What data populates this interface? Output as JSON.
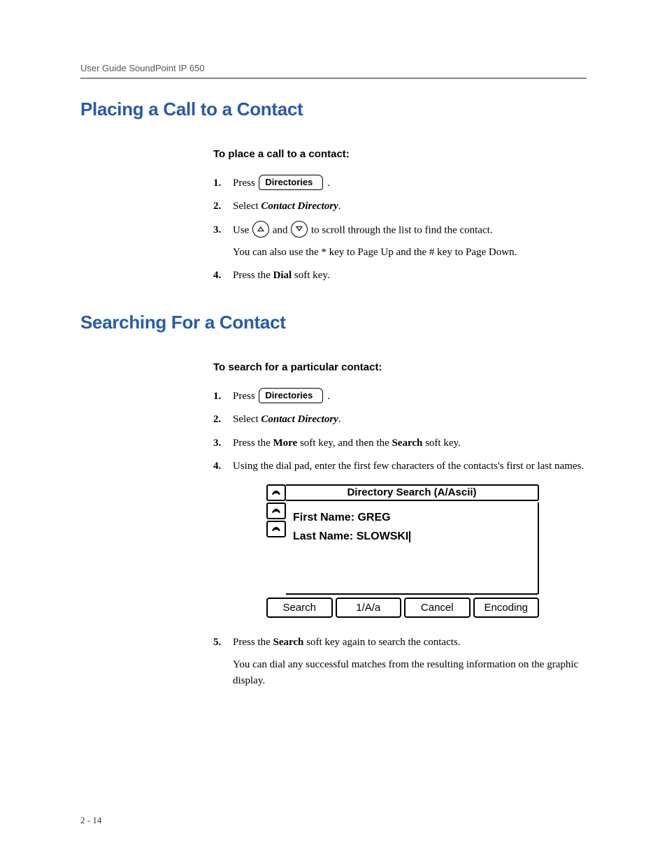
{
  "runningHead": "User Guide SoundPoint IP 650",
  "pageNumber": "2 - 14",
  "sections": {
    "placing": {
      "title": "Placing a Call to a Contact",
      "subhead": "To place a call to a contact:",
      "steps": {
        "s1_pre": "Press ",
        "s1_btn": "Directories",
        "s1_post": " .",
        "s2_pre": "Select ",
        "s2_ital": "Contact Directory",
        "s2_post": ".",
        "s3_pre": "Use ",
        "s3_mid": " and ",
        "s3_post": " to scroll through the list to find the contact.",
        "s3_extra": "You can also use the * key to Page Up and the # key to Page Down.",
        "s4_pre": "Press the ",
        "s4_bold": "Dial",
        "s4_post": " soft key."
      }
    },
    "searching": {
      "title": "Searching For a Contact",
      "subhead": "To search for a particular contact:",
      "steps": {
        "s1_pre": "Press ",
        "s1_btn": "Directories",
        "s1_post": " .",
        "s2_pre": "Select ",
        "s2_ital": "Contact Directory",
        "s2_post": ".",
        "s3_pre": "Press the ",
        "s3_b1": "More",
        "s3_mid": " soft key, and then the ",
        "s3_b2": "Search",
        "s3_post": " soft key.",
        "s4": "Using the dial pad, enter the first few characters of the contacts's first or last names.",
        "s5_pre": "Press the ",
        "s5_bold": "Search",
        "s5_post": " soft key again to search the contacts.",
        "s5_extra": "You can dial any successful matches from the resulting information on the graphic display."
      }
    }
  },
  "phoneScreen": {
    "title": "Directory Search (A/Ascii)",
    "fields": {
      "firstLabel": "First Name:",
      "firstValue": "GREG",
      "lastLabel": "Last Name:",
      "lastValue": "SLOWSKI"
    },
    "softkeys": [
      "Search",
      "1/A/a",
      "Cancel",
      "Encoding"
    ]
  }
}
